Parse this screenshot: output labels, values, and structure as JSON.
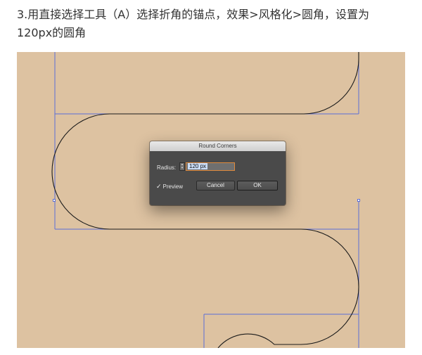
{
  "instruction": {
    "line1": "3.用直接选择工具（A）选择折角的锚点，效果>风格化>圆角，设置为",
    "line2": "120px的圆角"
  },
  "canvas": {
    "background_color": "#ddc2a1",
    "path_color": "#1a1a1a",
    "guide_color": "#5b6fd6"
  },
  "dialog": {
    "title": "Round Corners",
    "radius_label": "Radius:",
    "radius_value": "120 px",
    "stepper_icon": "up-down-stepper-icon",
    "preview_label": "Preview",
    "preview_checked": true,
    "check_icon": "checkmark-icon",
    "cancel_label": "Cancel",
    "ok_label": "OK"
  }
}
